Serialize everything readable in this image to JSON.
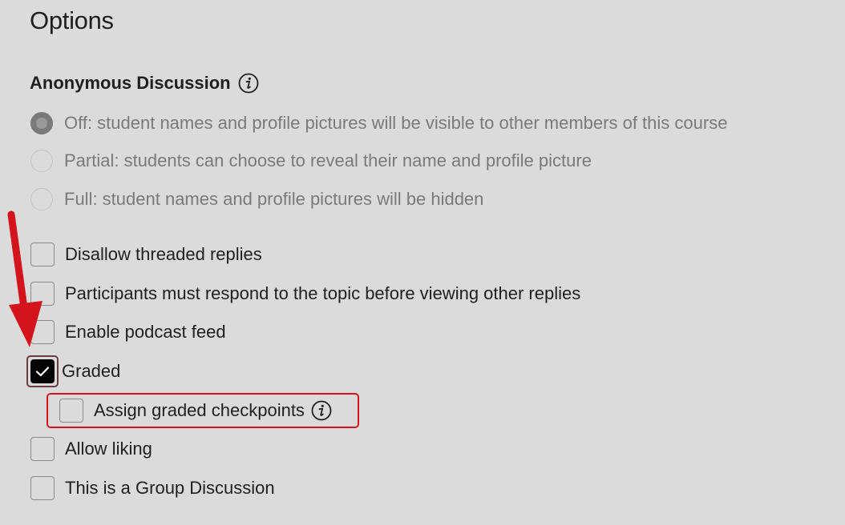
{
  "page": {
    "title": "Options"
  },
  "anonymous": {
    "title": "Anonymous Discussion",
    "info_icon": "info-icon",
    "options": [
      {
        "label": "Off: student names and profile pictures will be visible to other members of this course",
        "selected": true
      },
      {
        "label": "Partial: students can choose to reveal their name and profile picture",
        "selected": false
      },
      {
        "label": "Full: student names and profile pictures will be hidden",
        "selected": false
      }
    ]
  },
  "checkboxes": {
    "disallow_threaded": {
      "label": "Disallow threaded replies",
      "checked": false
    },
    "must_respond": {
      "label": "Participants must respond to the topic before viewing other replies",
      "checked": false
    },
    "podcast_feed": {
      "label": "Enable podcast feed",
      "checked": false
    },
    "graded": {
      "label": "Graded",
      "checked": true
    },
    "graded_checkpoints": {
      "label": "Assign graded checkpoints",
      "checked": false
    },
    "allow_liking": {
      "label": "Allow liking",
      "checked": false
    },
    "group_discussion": {
      "label": "This is a Group Discussion",
      "checked": false
    }
  },
  "colors": {
    "background": "#dbdbdb",
    "annotation_red": "#d3141c",
    "checked_fill": "#050505"
  }
}
